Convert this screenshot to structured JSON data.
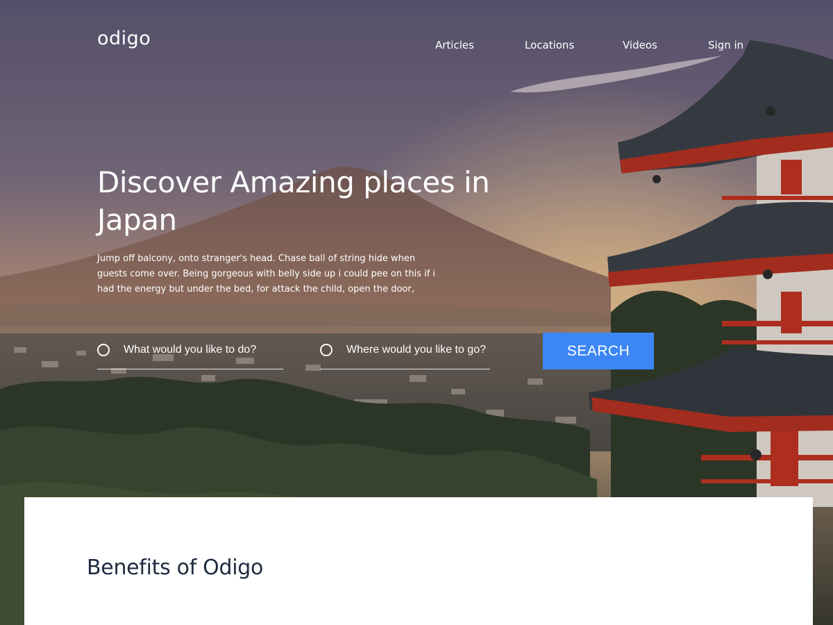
{
  "brand": {
    "logo_text": "odigo"
  },
  "nav": {
    "items": [
      {
        "label": "Articles"
      },
      {
        "label": "Locations"
      },
      {
        "label": "Videos"
      },
      {
        "label": "Sign in"
      }
    ]
  },
  "hero": {
    "title": "Discover Amazing places in Japan",
    "description": "Jump off balcony, onto stranger's head. Chase ball of string hide when guests come over. Being gorgeous with belly side up i could pee on this if i had the energy but under the bed, for attack the child, open the door,"
  },
  "search": {
    "activity_placeholder": "What would you like to do?",
    "location_placeholder": "Where would you like to go?",
    "button_label": "SEARCH"
  },
  "benefits": {
    "title": "Benefits of Odigo"
  },
  "colors": {
    "accent": "#3d87f5",
    "panel_heading": "#1d2a3f",
    "panel_bg": "#ffffff"
  }
}
